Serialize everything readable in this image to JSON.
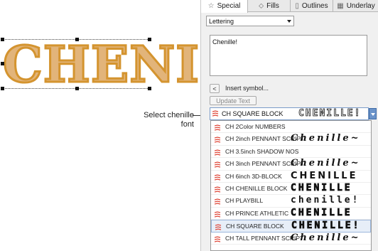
{
  "canvas": {
    "lettering_text": "CHENIL"
  },
  "callout": {
    "line1": "Select chenille",
    "line2": "font"
  },
  "tabs": [
    {
      "label": "Special",
      "icon": "star-icon"
    },
    {
      "label": "Fills",
      "icon": "fill-icon"
    },
    {
      "label": "Outlines",
      "icon": "outline-icon"
    },
    {
      "label": "Underlay",
      "icon": "underlay-icon"
    }
  ],
  "object_type": {
    "value": "Lettering"
  },
  "text_box": {
    "value": "Chenille!"
  },
  "insert_symbol": {
    "button": "<",
    "label": "Insert symbol..."
  },
  "update_text": {
    "label": "Update Text"
  },
  "font": {
    "selected_name": "CH SQUARE BLOCK",
    "selected_preview": "CHENILLE!",
    "options": [
      {
        "name": "CH 2Color NUMBERS",
        "preview": "",
        "style": "none"
      },
      {
        "name": "CH 2inch PENNANT SCRIPT",
        "preview": "Chenille~",
        "style": "script"
      },
      {
        "name": "CH 3.5inch SHADOW NOS",
        "preview": "",
        "style": "none"
      },
      {
        "name": "CH 3inch PENNANT SCRIPT",
        "preview": "Chenille~",
        "style": "script"
      },
      {
        "name": "CH 6inch 3D-BLOCK",
        "preview": "CHENILLE",
        "style": "block"
      },
      {
        "name": "CH CHENILLE BLOCK",
        "preview": "CHENILLE",
        "style": "outline"
      },
      {
        "name": "CH PLAYBILL",
        "preview": "chenille!",
        "style": "bill"
      },
      {
        "name": "CH PRINCE ATHLETIC",
        "preview": "CHENILLE",
        "style": "outline"
      },
      {
        "name": "CH SQUARE BLOCK",
        "preview": "CHENILLE!",
        "style": "outline",
        "selected": true
      },
      {
        "name": "CH TALL PENNANT SCRIPT",
        "preview": "Chenille~",
        "style": "script"
      }
    ]
  },
  "colors": {
    "accent": "#6b93c9",
    "zigzag": "#e0483a",
    "chenille_fill": "#e2b47a",
    "chenille_edge": "#c65fd6"
  }
}
